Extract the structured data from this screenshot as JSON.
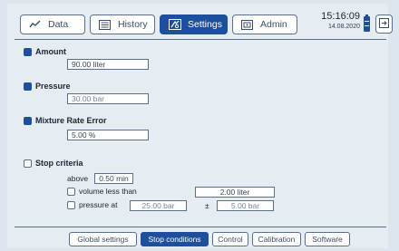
{
  "tabs": [
    {
      "label": "Data",
      "icon": "chart-line-icon",
      "active": false
    },
    {
      "label": "History",
      "icon": "list-icon",
      "active": false
    },
    {
      "label": "Settings",
      "icon": "settings-icon",
      "active": true
    },
    {
      "label": "Admin",
      "icon": "admin-icon",
      "active": false
    }
  ],
  "status": {
    "time": "15:16:09",
    "date": "14.08.2020"
  },
  "sections": {
    "amount": {
      "title": "Amount",
      "checked": true,
      "value": "90.00 liter"
    },
    "pressure": {
      "title": "Pressure",
      "checked": true,
      "value": "30.00 bar"
    },
    "mixture": {
      "title": "Mixture Rate Error",
      "checked": true,
      "value": "5.00 %"
    },
    "stop": {
      "title": "Stop criteria",
      "checked": false,
      "above_label": "above",
      "above_value": "0.50 min",
      "volume_label": "volume less than",
      "volume_value": "2.00 liter",
      "pressure_label": "pressure at",
      "pressure_value": "25.00 bar",
      "tolerance_symbol": "±",
      "tolerance_value": "5.00 bar"
    }
  },
  "bottom_tabs": [
    {
      "label": "Global settings",
      "active": false
    },
    {
      "label": "Stop conditions",
      "active": true
    },
    {
      "label": "Control",
      "active": false
    },
    {
      "label": "Calibration",
      "active": false
    },
    {
      "label": "Software",
      "active": false
    }
  ],
  "colors": {
    "accent": "#1e4f9c",
    "background": "#e5edf2",
    "border": "#5a6f8c"
  }
}
